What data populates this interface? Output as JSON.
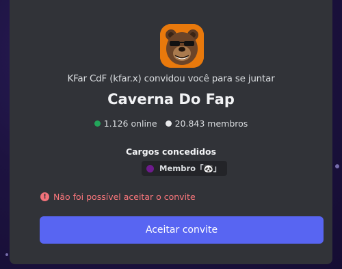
{
  "invite": {
    "inviter_text": "KFar CdF (kfar.x) convidou você para se juntar",
    "server_name": "Caverna Do Fap",
    "online_count": "1.126 online",
    "member_count": "20.843 membros",
    "avatar_icon": "bear-with-sunglasses-icon"
  },
  "roles": {
    "title": "Cargos concedidos",
    "items": [
      {
        "label": "Membro「🐼」",
        "color": "#6d1b8c"
      }
    ]
  },
  "error": {
    "icon": "alert-icon",
    "message": "Não foi possível aceitar o convite"
  },
  "actions": {
    "accept_label": "Aceitar convite"
  },
  "colors": {
    "accent": "#5865f2",
    "online": "#23a55a",
    "error": "#fa777c",
    "avatar_bg": "#e8790c"
  }
}
